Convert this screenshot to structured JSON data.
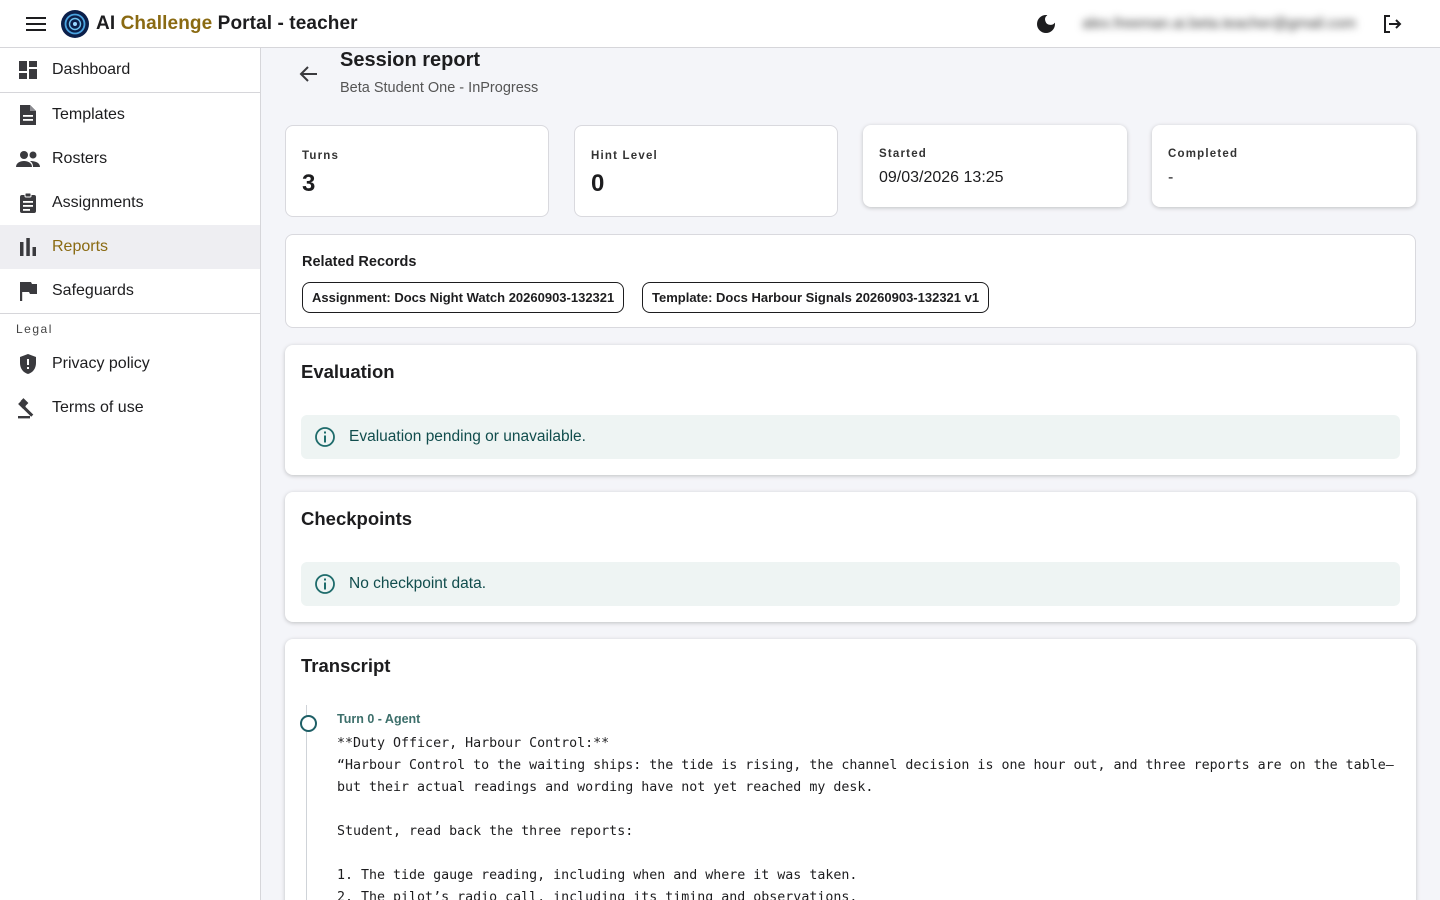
{
  "topbar": {
    "brand_part1": "AI ",
    "brand_part2": "Challenge",
    "brand_part3": " Portal - teacher",
    "user_email": "alex.freeman.ai.beta.teacher@gmail.com",
    "icons": [
      "menu-icon",
      "logo-icon",
      "dark-mode-icon",
      "logout-icon"
    ]
  },
  "sidebar": {
    "items": [
      {
        "label": "Dashboard",
        "icon": "dashboard-icon"
      },
      {
        "label": "Templates",
        "icon": "document-icon"
      },
      {
        "label": "Rosters",
        "icon": "people-icon"
      },
      {
        "label": "Assignments",
        "icon": "clipboard-icon"
      },
      {
        "label": "Reports",
        "icon": "bar-chart-icon",
        "active": true
      },
      {
        "label": "Safeguards",
        "icon": "flag-icon"
      }
    ],
    "legal_section": "Legal",
    "legal_items": [
      {
        "label": "Privacy policy",
        "icon": "shield-icon"
      },
      {
        "label": "Terms of use",
        "icon": "gavel-icon"
      }
    ]
  },
  "report": {
    "title": "Session report",
    "subtitle": "Beta Student One - InProgress",
    "stats": {
      "turns_label": "Turns",
      "turns_value": "3",
      "hint_label": "Hint Level",
      "hint_value": "0",
      "started_label": "Started",
      "started_value": "09/03/2026 13:25",
      "completed_label": "Completed",
      "completed_value": "-"
    },
    "related": {
      "title": "Related Records",
      "assignment_chip": "Assignment: Docs Night Watch 20260903-132321",
      "template_chip": "Template: Docs Harbour Signals 20260903-132321 v1"
    },
    "evaluation": {
      "title": "Evaluation",
      "message": "Evaluation pending or unavailable."
    },
    "checkpoints": {
      "title": "Checkpoints",
      "message": "No checkpoint data."
    },
    "transcript": {
      "title": "Transcript",
      "turns": [
        {
          "meta": "Turn 0 - Agent",
          "text": "**Duty Officer, Harbour Control:**\n“Harbour Control to the waiting ships: the tide is rising, the channel decision is one hour out, and three reports are on the table—but their actual readings and wording have not yet reached my desk.\n\nStudent, read back the three reports:\n\n1. The tide gauge reading, including when and where it was taken.\n2. The pilot’s radio call, including its timing and observations."
        }
      ]
    }
  }
}
